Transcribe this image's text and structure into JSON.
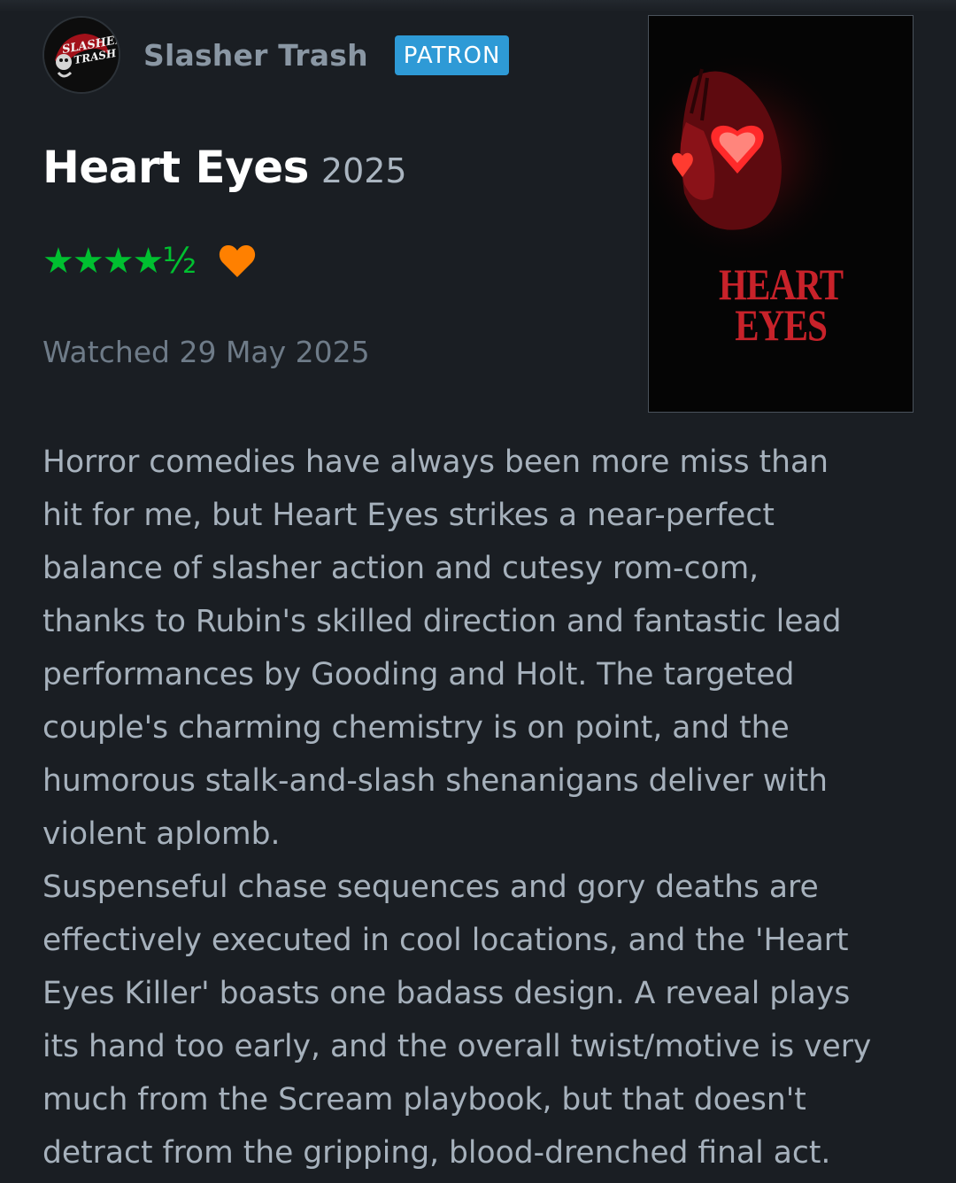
{
  "reviewer": {
    "name": "Slasher Trash",
    "badge": "PATRON",
    "avatar_text": "SLASHER TRASH"
  },
  "film": {
    "title": "Heart Eyes",
    "year": "2025",
    "poster_title_line1": "HEART",
    "poster_title_line2": "EYES"
  },
  "rating": {
    "stars": 4.5,
    "display": "★★★★½",
    "liked": true,
    "star_color": "#00c030",
    "heart_color": "#ff8000"
  },
  "watched_date": "Watched 29 May 2025",
  "review": {
    "lines": [
      "Horror comedies have always been more miss than",
      "hit for me, but Heart Eyes strikes a near-perfect",
      "balance of slasher action and cutesy rom-com,",
      "thanks to Rubin's skilled direction and fantastic lead",
      "performances by Gooding and Holt. The targeted",
      "couple's charming chemistry is on point, and the",
      "humorous stalk-and-slash shenanigans deliver with",
      "violent aplomb.",
      "Suspenseful chase sequences and gory deaths are",
      "effectively executed in cool locations, and the 'Heart",
      "Eyes Killer' boasts one badass design. A reveal plays",
      "its hand too early, and the overall twist/motive is very",
      "much from the Scream playbook, but that doesn't",
      "detract from the gripping, blood-drenched final act."
    ]
  },
  "colors": {
    "background": "#1a1e23",
    "badge": "#2e9ad6",
    "poster_text": "#c8222a"
  }
}
